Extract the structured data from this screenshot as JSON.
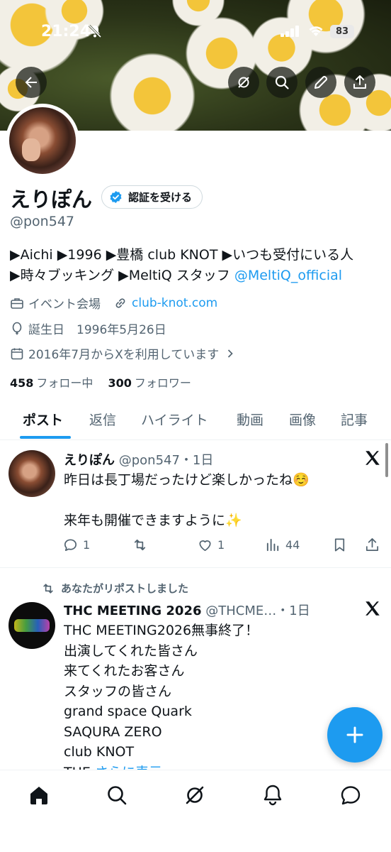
{
  "status_bar": {
    "time": "21:24",
    "battery": "83"
  },
  "header_buttons": [
    {
      "name": "back-button",
      "icon": "arrow-left-icon"
    },
    {
      "name": "grok-button",
      "icon": "grok-icon"
    },
    {
      "name": "search-button",
      "icon": "search-icon"
    },
    {
      "name": "edit-button",
      "icon": "pencil-icon"
    },
    {
      "name": "share-button",
      "icon": "share-icon"
    }
  ],
  "profile": {
    "display_name": "えりぽん",
    "verify_label": "認証を受ける",
    "handle": "@pon547",
    "bio_line1": "▶Aichi ▶1996 ▶豊橋 club KNOT ▶いつも受付にいる人",
    "bio_line2_text": "▶時々ブッキング ▶MeltiQ スタッフ ",
    "bio_line2_mention": "@MeltiQ_official",
    "category": "イベント会場",
    "website": "club-knot.com",
    "birthday": "誕生日　1996年5月26日",
    "joined": "2016年7月からXを利用しています",
    "following_count": "458",
    "following_label": "フォロー中",
    "followers_count": "300",
    "followers_label": "フォロワー"
  },
  "tabs": [
    "ポスト",
    "返信",
    "ハイライト",
    "動画",
    "画像",
    "記事"
  ],
  "tweets": [
    {
      "name": "えりぽん",
      "handle_time": "@pon547・1日",
      "lines": [
        "昨日は長丁場だったけど楽しかったね☺️",
        "",
        "来年も開催できますように✨"
      ],
      "replies": "1",
      "reposts": "",
      "likes": "1",
      "views": "44"
    },
    {
      "repost_note": "あなたがリポストしました",
      "name": "THC MEETING 2026",
      "handle_time": "@THCME…・1日",
      "lines": [
        "THC MEETING2026無事終了！",
        "出演してくれた皆さん",
        "来てくれたお客さん",
        "スタッフの皆さん",
        "grand space Quark",
        "SAQURA ZERO",
        "club KNOT"
      ],
      "truncated_prefix": "THE ",
      "show_more": "さらに表示"
    }
  ],
  "colors": {
    "accent": "#1d9bf0",
    "text": "#0f1419",
    "secondary": "#536471"
  },
  "bottom_nav": [
    "home-icon",
    "search-icon",
    "grok-icon",
    "bell-icon",
    "chat-icon"
  ]
}
